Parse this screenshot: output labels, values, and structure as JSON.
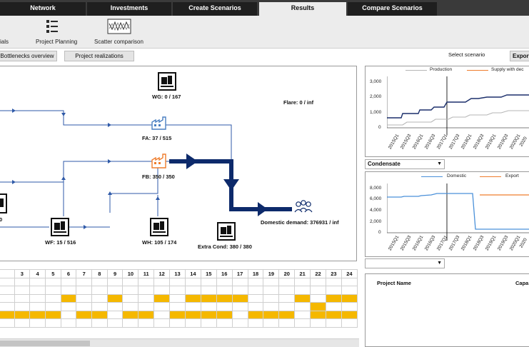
{
  "tabs": [
    {
      "label": "Network",
      "active": false
    },
    {
      "label": "Investments",
      "active": false
    },
    {
      "label": "Create Scenarios",
      "active": false
    },
    {
      "label": "Results",
      "active": true
    },
    {
      "label": "Compare Scenarios",
      "active": false
    }
  ],
  "ribbon": {
    "partial_label": "ials",
    "project_planning": "Project Planning",
    "scatter_comparison": "Scatter comparison"
  },
  "subtoolbar": {
    "bottlenecks": "Bottlenecks overview",
    "realizations": "Project realizations",
    "select_scenario": "Select scenario",
    "export": "Export"
  },
  "network": {
    "wg": "WG: 0 / 167",
    "flare": "Flare: 0 / inf",
    "fa": "FA: 37 / 515",
    "fb": "FB: 350 / 350",
    "domestic": "Domestic demand: 376931 / inf",
    "wf": "WF: 15 / 516",
    "wh": "WH: 105 / 174",
    "extra_cond": "Extra Cond: 380 / 380",
    "partial_left": "0"
  },
  "chart_top": {
    "legend": [
      "Production",
      "Supply with dec"
    ],
    "yticks": [
      "3,000",
      "2,000",
      "1,000",
      "0"
    ],
    "xticks": [
      "2015Q1",
      "2015Q3",
      "2016Q1",
      "2016Q3",
      "2017Q1",
      "2017Q3",
      "2018Q1",
      "2018Q3",
      "2019Q1",
      "2019Q3",
      "2020Q1",
      "2020"
    ]
  },
  "condensate_dropdown": "Condensate",
  "chart_bottom": {
    "legend": [
      "Domestic",
      "Export"
    ],
    "yticks": [
      "8,000",
      "6,000",
      "4,000",
      "2,000",
      "0"
    ],
    "xticks": [
      "2015Q1",
      "2015Q3",
      "2016Q1",
      "2016Q3",
      "2017Q1",
      "2017Q3",
      "2018Q1",
      "2018Q3",
      "2019Q1",
      "2019Q3",
      "2020Q1",
      "2020"
    ]
  },
  "project_table": {
    "col_name": "Project Name",
    "col_capacity": "Capa"
  },
  "timeline": {
    "headers": [
      "",
      "3",
      "4",
      "5",
      "6",
      "7",
      "8",
      "9",
      "10",
      "11",
      "12",
      "13",
      "14",
      "15",
      "16",
      "17",
      "18",
      "19",
      "20",
      "21",
      "22",
      "23",
      "24"
    ],
    "rows": [
      [
        0,
        0,
        0,
        0,
        0,
        0,
        0,
        0,
        0,
        0,
        0,
        0,
        0,
        0,
        0,
        0,
        0,
        0,
        0,
        0,
        0,
        0,
        0
      ],
      [
        0,
        0,
        0,
        0,
        0,
        0,
        0,
        0,
        0,
        0,
        0,
        0,
        0,
        0,
        0,
        0,
        0,
        0,
        0,
        0,
        0,
        0,
        0
      ],
      [
        0,
        0,
        0,
        0,
        1,
        0,
        0,
        1,
        0,
        0,
        1,
        0,
        1,
        1,
        1,
        1,
        0,
        0,
        0,
        1,
        0,
        1,
        1
      ],
      [
        0,
        0,
        0,
        0,
        0,
        0,
        0,
        0,
        0,
        0,
        0,
        0,
        0,
        0,
        0,
        0,
        0,
        0,
        0,
        0,
        1,
        0,
        0
      ],
      [
        1,
        1,
        1,
        1,
        0,
        1,
        1,
        0,
        1,
        1,
        0,
        1,
        1,
        1,
        1,
        0,
        1,
        1,
        1,
        0,
        1,
        1,
        1
      ],
      [
        0,
        0,
        0,
        0,
        0,
        0,
        0,
        0,
        0,
        0,
        0,
        0,
        0,
        0,
        0,
        0,
        0,
        0,
        0,
        0,
        0,
        0,
        0
      ]
    ]
  },
  "colors": {
    "flow_heavy": "#0d2a6b",
    "flow_light": "#2f5aa8",
    "production_line": "#1b2f6b",
    "supply_line": "#b5b5b5",
    "domestic_line": "#4a90d9",
    "export_line": "#ef7d2d",
    "timeline_on": "#f5b800"
  }
}
